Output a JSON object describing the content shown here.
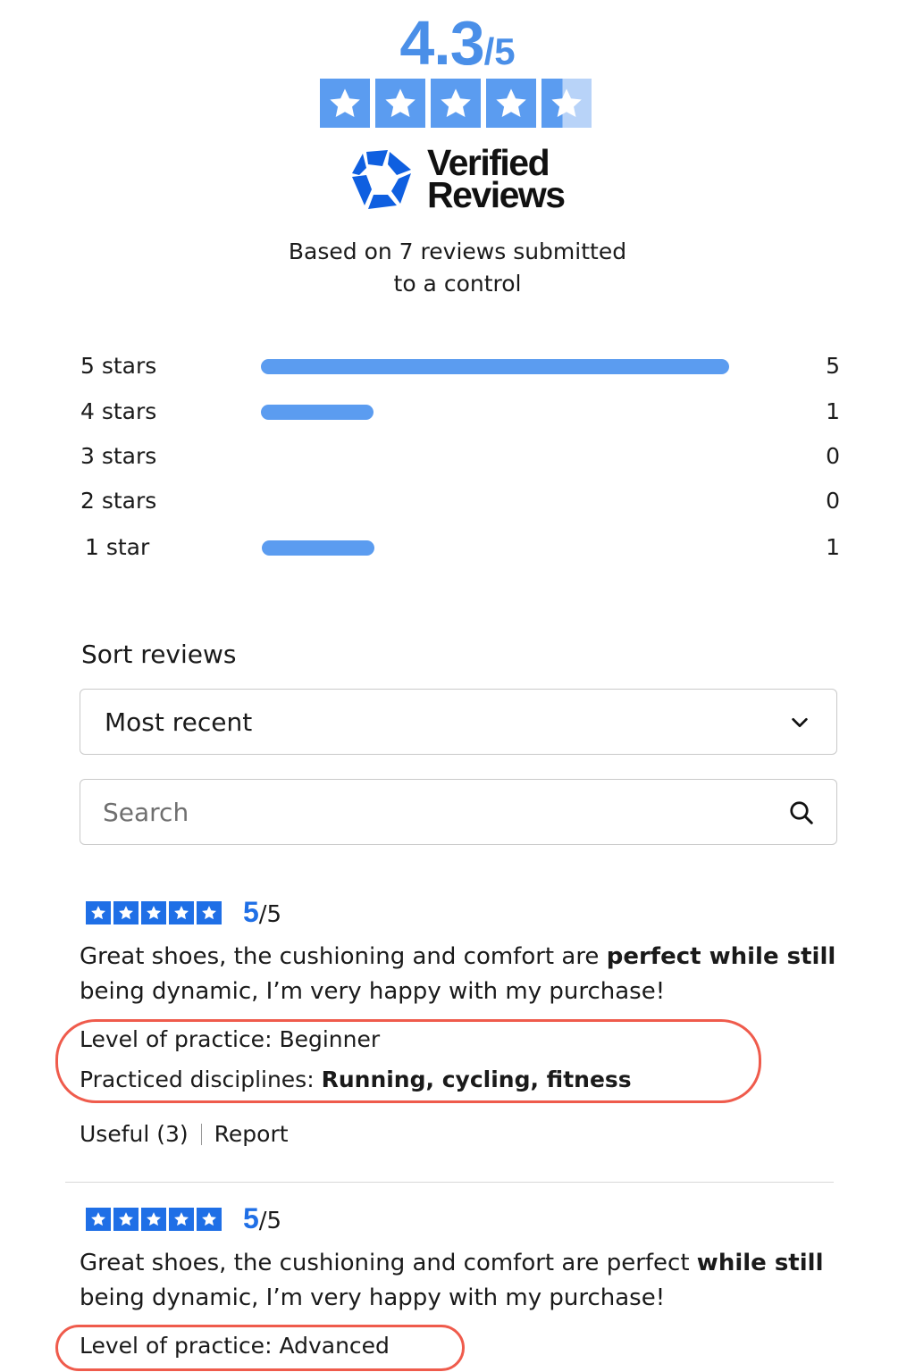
{
  "summary": {
    "score": "4.3",
    "out_of": "/5",
    "rating_value": 4.3,
    "brand_line1": "Verified",
    "brand_line2": "Reviews",
    "based_line1": "Based on 7 reviews submitted",
    "based_line2": "to a control"
  },
  "distribution": [
    {
      "label": "5 stars",
      "count": "5",
      "fraction": 1.0
    },
    {
      "label": "4 stars",
      "count": "1",
      "fraction": 0.2
    },
    {
      "label": "3 stars",
      "count": "0",
      "fraction": 0
    },
    {
      "label": "2 stars",
      "count": "0",
      "fraction": 0
    },
    {
      "label": "1 star",
      "count": "1",
      "fraction": 0.2
    }
  ],
  "sort": {
    "title": "Sort reviews",
    "selected": "Most recent"
  },
  "search": {
    "placeholder": "Search"
  },
  "reviews": [
    {
      "score": "5",
      "out_of": "/5",
      "stars": 5,
      "text_plain": "Great shoes, the cushioning and comfort are ",
      "text_bold": "perfect while still",
      "text_rest": "being dynamic, I’m very happy with my purchase!",
      "level_label": "Level of practice: ",
      "level_value": "Beginner",
      "disciplines_label": "Practiced disciplines: ",
      "disciplines_value": "Running, cycling, fitness",
      "useful": "Useful (3)",
      "report": "Report"
    },
    {
      "score": "5",
      "out_of": "/5",
      "stars": 5,
      "text_plain": "Great shoes, the cushioning and comfort are perfect ",
      "text_bold": "while still",
      "text_rest": "being dynamic, I’m very happy with my purchase!",
      "level_label": "Level of practice: ",
      "level_value": "Advanced"
    }
  ],
  "colors": {
    "accent": "#5b9cf0",
    "brand_blue": "#1f6fe6",
    "highlight_oval": "#ef5b4c"
  },
  "icons": [
    "star-icon",
    "verified-reviews-logo-icon",
    "chevron-down-icon",
    "search-icon"
  ]
}
